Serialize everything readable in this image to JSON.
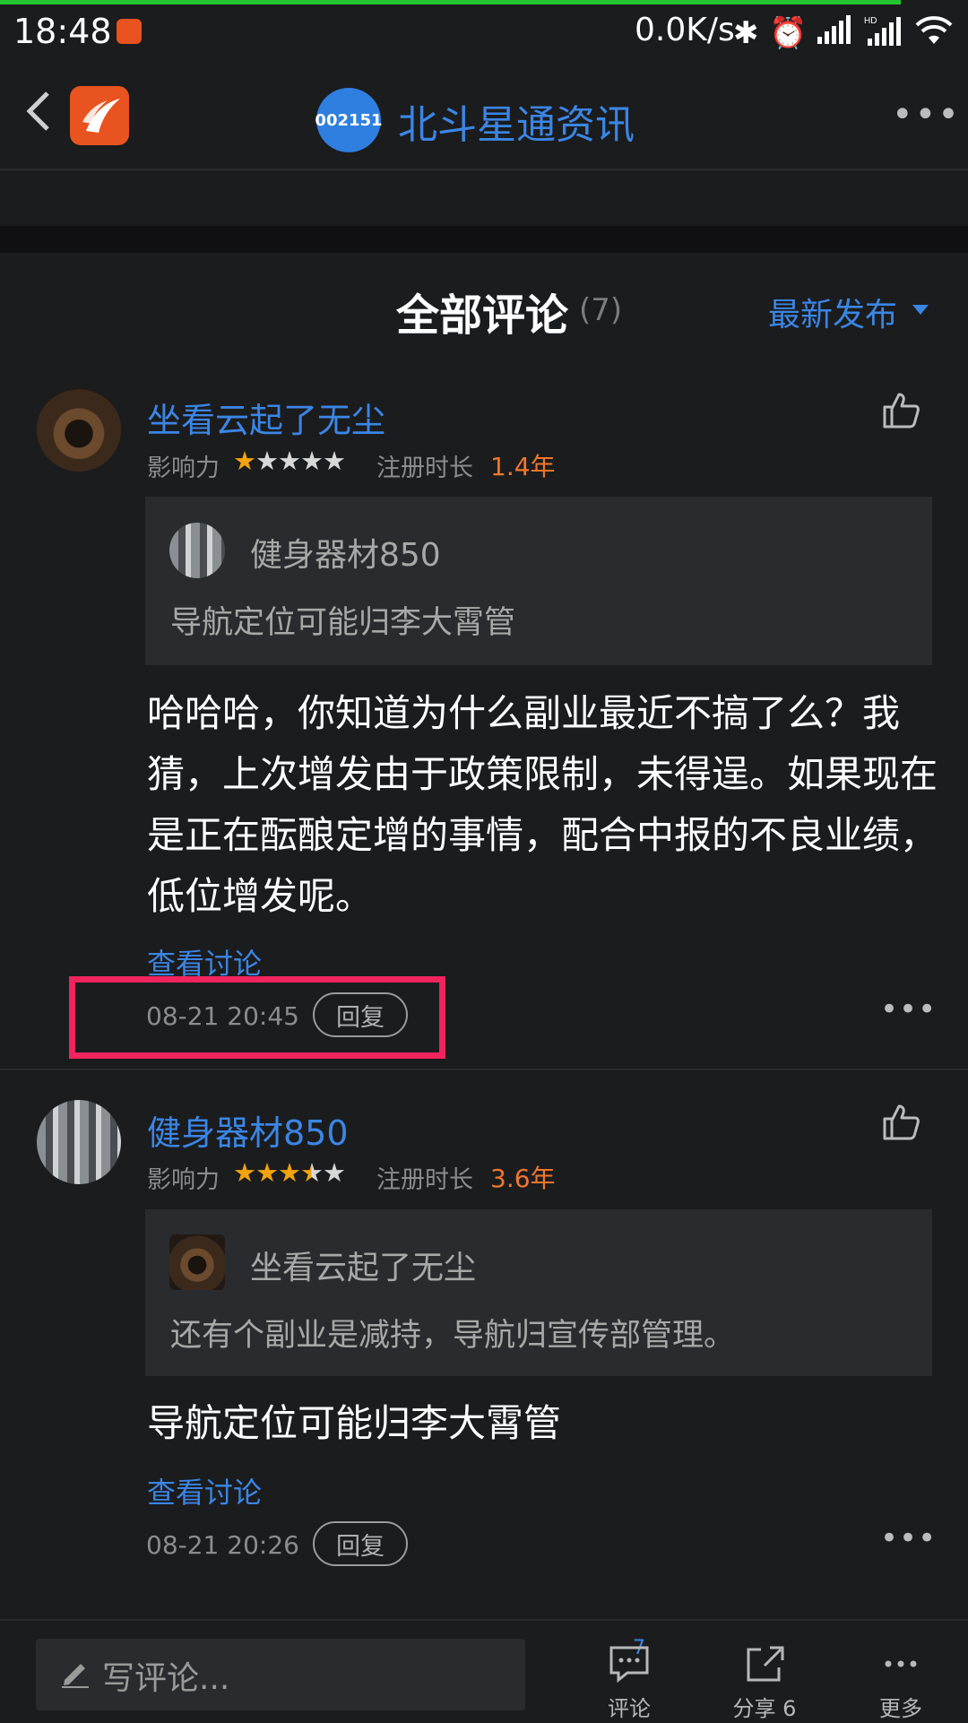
{
  "status": {
    "time": "18:48",
    "speed": "0.0K/s"
  },
  "header": {
    "stock_code": "002151",
    "title": "北斗星通资讯",
    "more": "•••"
  },
  "comments_section": {
    "title": "全部评论",
    "count": "(7)",
    "sort_label": "最新发布"
  },
  "comments": [
    {
      "user": "坐看云起了无尘",
      "influence_label": "影响力",
      "stars": [
        1,
        0,
        0,
        0,
        0
      ],
      "reg_label": "注册时长",
      "reg_value": "1.4年",
      "quote": {
        "user": "健身器材850",
        "text": "导航定位可能归李大霄管"
      },
      "body": "哈哈哈，你知道为什么副业最近不搞了么？我猜，上次增发由于政策限制，未得逞。如果现在是正在酝酿定增的事情，配合中报的不良业绩，低位增发呢。",
      "view_discussion": "查看讨论",
      "time": "08-21 20:45",
      "reply": "回复"
    },
    {
      "user": "健身器材850",
      "influence_label": "影响力",
      "stars": [
        1,
        1,
        1,
        0.5,
        0
      ],
      "reg_label": "注册时长",
      "reg_value": "3.6年",
      "quote": {
        "user": "坐看云起了无尘",
        "text": "还有个副业是减持，导航归宣传部管理。"
      },
      "body": "导航定位可能归李大霄管",
      "view_discussion": "查看讨论",
      "time": "08-21 20:26",
      "reply": "回复"
    }
  ],
  "bottom_bar": {
    "write_placeholder": "写评论...",
    "comment_label": "评论",
    "comment_badge": "7",
    "share_label": "分享 6",
    "more_label": "更多"
  },
  "colors": {
    "accent": "#3b86e5",
    "background": "#1b1c1e",
    "highlight": "#f1245e",
    "star": "#f3a30d",
    "orange": "#f0772b"
  },
  "icons": [
    "back-icon",
    "app-logo-icon",
    "more-icon",
    "like-icon",
    "pencil-icon",
    "comment-icon",
    "share-icon",
    "more-dots-icon"
  ]
}
